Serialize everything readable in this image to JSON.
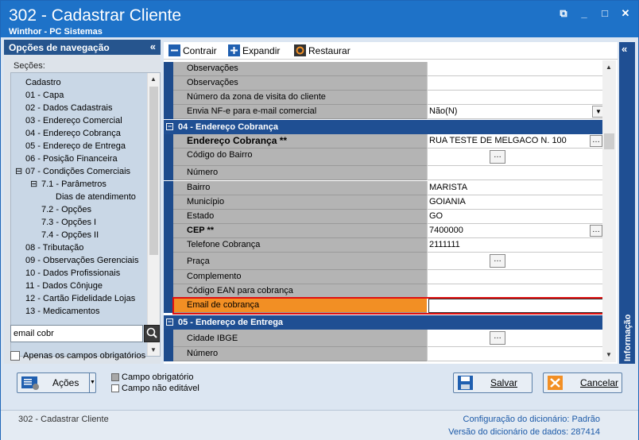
{
  "window": {
    "title": "302 - Cadastrar Cliente",
    "subtitle": "Winthor - PC Sistemas"
  },
  "nav": {
    "header": "Opções de navegação",
    "secoes_label": "Seções:",
    "items": [
      "Cadastro",
      "01 - Capa",
      "02 - Dados Cadastrais",
      "03 - Endereço Comercial",
      "04 - Endereço Cobrança",
      "05 - Endereço de Entrega",
      "06 - Posição Financeira",
      "07 - Condições Comerciais",
      "7.1 - Parâmetros",
      "Dias de atendimento",
      "7.2 - Opções",
      "7.3 - Opções I",
      "7.4 - Opções II",
      "08 - Tributação",
      "09 - Observações Gerenciais",
      "10 - Dados Profissionais",
      "11 - Dados Cônjuge",
      "12 - Cartão Fidelidade Lojas",
      "13 - Medicamentos"
    ],
    "search_value": "email cobr",
    "required_only_label": "Apenas os campos obrigatórios"
  },
  "toolbar": {
    "collapse": "Contrair",
    "expand": "Expandir",
    "restore": "Restaurar"
  },
  "grid": {
    "rows": [
      {
        "label": "Observações",
        "value": ""
      },
      {
        "label": "Observações",
        "value": ""
      },
      {
        "label": "Número da zona de visita do cliente",
        "value": ""
      },
      {
        "label": "Envia NF-e para e-mail comercial",
        "value": "Não(N)"
      }
    ],
    "section04": "04 - Endereço Cobrança",
    "rows04": [
      {
        "label": "Endereço Cobrança **",
        "value": "RUA TESTE DE MELGACO N. 100"
      },
      {
        "label": "Código do Bairro",
        "value": ""
      },
      {
        "label": "Número",
        "value": ""
      },
      {
        "label": "Bairro",
        "value": "MARISTA"
      },
      {
        "label": "Município",
        "value": "GOIANIA"
      },
      {
        "label": "Estado",
        "value": "GO"
      },
      {
        "label": "CEP **",
        "value": "7400000"
      },
      {
        "label": "Telefone Cobrança",
        "value": "2111111"
      },
      {
        "label": "Praça",
        "value": ""
      },
      {
        "label": "Complemento",
        "value": ""
      },
      {
        "label": "Código EAN para cobrança",
        "value": ""
      },
      {
        "label": "Email de cobrança",
        "value": ""
      }
    ],
    "section05": "05 - Endereço de Entrega",
    "rows05": [
      {
        "label": "Cidade IBGE",
        "value": ""
      },
      {
        "label": "Número",
        "value": ""
      }
    ]
  },
  "side_panel": {
    "label": "Informação"
  },
  "bottom": {
    "actions": "Ações",
    "legend_required": "Campo obrigatório",
    "legend_readonly": "Campo não editável",
    "save": "Salvar",
    "cancel": "Cancelar"
  },
  "status": {
    "left": "302 - Cadastrar Cliente",
    "dict_config": "Configuração do dicionário:",
    "dict_config_value": "Padrão",
    "dict_version": "Versão do dicionário de dados:",
    "dict_version_value": "287414"
  },
  "colors": {
    "title_bar": "#1e72c8",
    "nav_header": "#26558e",
    "category": "#1f4f93",
    "highlight": "#f28f24",
    "label_bg": "#b4b4b4"
  }
}
